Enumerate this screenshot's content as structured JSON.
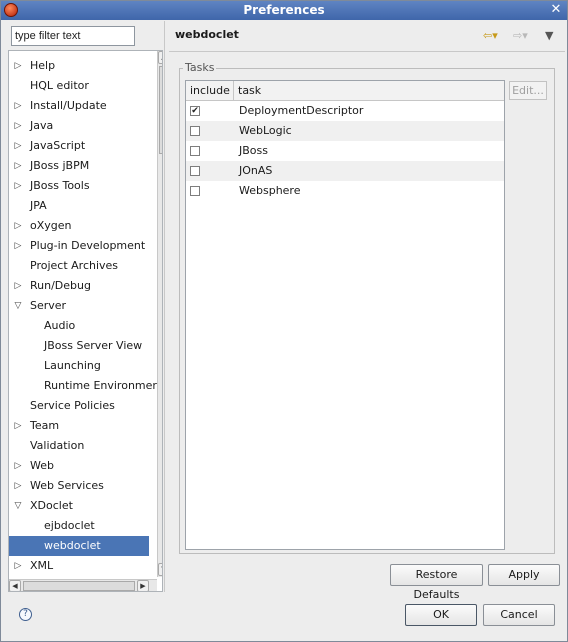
{
  "window": {
    "title": "Preferences"
  },
  "filter": {
    "placeholder": "type filter text"
  },
  "tree": [
    {
      "label": "Help",
      "arrow": "▷"
    },
    {
      "label": "HQL editor",
      "arrow": ""
    },
    {
      "label": "Install/Update",
      "arrow": "▷"
    },
    {
      "label": "Java",
      "arrow": "▷"
    },
    {
      "label": "JavaScript",
      "arrow": "▷"
    },
    {
      "label": "JBoss jBPM",
      "arrow": "▷"
    },
    {
      "label": "JBoss Tools",
      "arrow": "▷"
    },
    {
      "label": "JPA",
      "arrow": ""
    },
    {
      "label": "oXygen",
      "arrow": "▷"
    },
    {
      "label": "Plug-in Development",
      "arrow": "▷"
    },
    {
      "label": "Project Archives",
      "arrow": ""
    },
    {
      "label": "Run/Debug",
      "arrow": "▷"
    },
    {
      "label": "Server",
      "arrow": "▽"
    },
    {
      "label": "Audio",
      "arrow": ""
    },
    {
      "label": "JBoss Server View",
      "arrow": ""
    },
    {
      "label": "Launching",
      "arrow": ""
    },
    {
      "label": "Runtime Environmer",
      "arrow": ""
    },
    {
      "label": "Service Policies",
      "arrow": ""
    },
    {
      "label": "Team",
      "arrow": "▷"
    },
    {
      "label": "Validation",
      "arrow": ""
    },
    {
      "label": "Web",
      "arrow": "▷"
    },
    {
      "label": "Web Services",
      "arrow": "▷"
    },
    {
      "label": "XDoclet",
      "arrow": "▽"
    },
    {
      "label": "ejbdoclet",
      "arrow": ""
    },
    {
      "label": "webdoclet",
      "arrow": "",
      "selected": true
    },
    {
      "label": "XML",
      "arrow": "▷"
    }
  ],
  "page": {
    "title": "webdoclet",
    "group_label": "Tasks",
    "columns": [
      "include",
      "task"
    ],
    "tasks": [
      {
        "name": "DeploymentDescriptor",
        "checked": true
      },
      {
        "name": "WebLogic",
        "checked": false
      },
      {
        "name": "JBoss",
        "checked": false
      },
      {
        "name": "JOnAS",
        "checked": false
      },
      {
        "name": "Websphere",
        "checked": false
      }
    ],
    "edit_label": "Edit...",
    "restore_label": "Restore Defaults",
    "apply_label": "Apply"
  },
  "footer": {
    "ok_label": "OK",
    "cancel_label": "Cancel"
  },
  "icons": {
    "back": "back-arrow-icon",
    "forward": "forward-arrow-icon",
    "menu": "view-menu-icon",
    "help": "help-icon",
    "close": "close-icon"
  }
}
